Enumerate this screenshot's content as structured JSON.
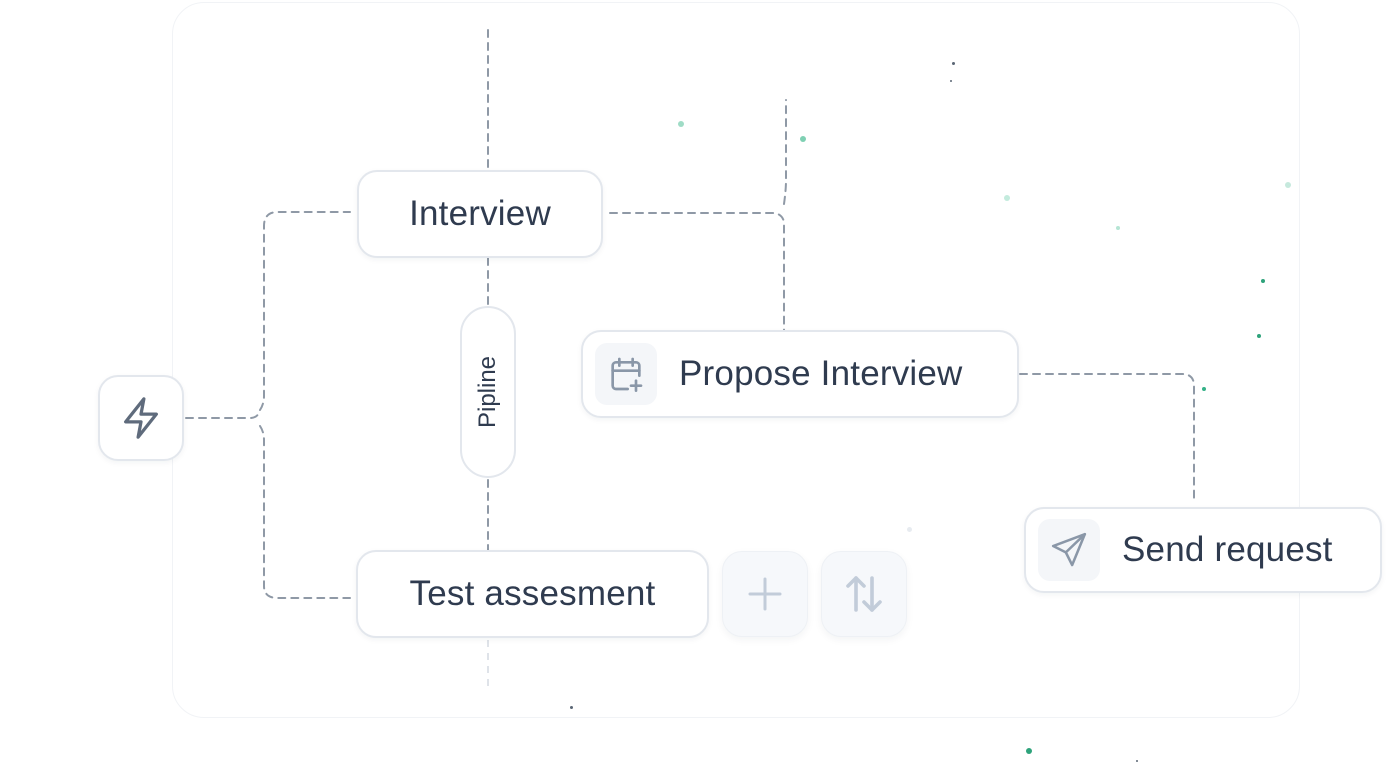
{
  "nodes": {
    "trigger": {
      "icon": "lightning-icon"
    },
    "interview": {
      "label": "Interview"
    },
    "pipeline": {
      "label": "Pipline"
    },
    "propose_interview": {
      "label": "Propose Interview",
      "icon": "calendar-plus-icon"
    },
    "test_assessment": {
      "label": "Test assesment"
    },
    "send_request": {
      "label": "Send request",
      "icon": "send-icon"
    }
  },
  "actions": {
    "add": {
      "icon": "plus-icon"
    },
    "reorder": {
      "icon": "swap-vertical-icon"
    }
  },
  "colors": {
    "text": "#2f3b4f",
    "icon": "#5f6b7c",
    "icon_muted": "#c2ccd9",
    "border": "#e3e7ed",
    "connector": "#8f99a6",
    "accent_dots": "#34b187"
  }
}
